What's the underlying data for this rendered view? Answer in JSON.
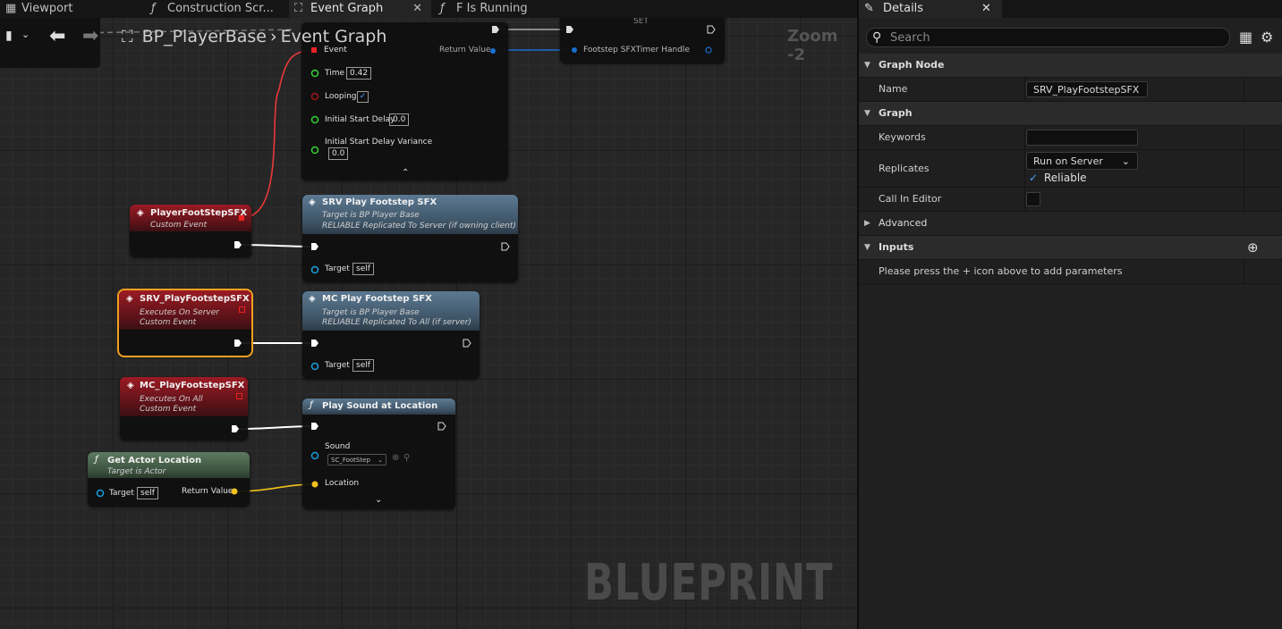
{
  "tabs": [
    {
      "label": "Viewport",
      "icon": "viewport-icon"
    },
    {
      "label": "Construction Scr...",
      "icon": "function-icon"
    },
    {
      "label": "Event Graph",
      "icon": "event-graph-icon",
      "active": true
    },
    {
      "label": "F Is Running",
      "icon": "function-icon"
    }
  ],
  "breadcrumb": {
    "blueprint": "BP_PlayerBase",
    "graph": "Event Graph"
  },
  "zoom": "Zoom -2",
  "watermark": "BLUEPRINT",
  "timer_node": {
    "set_label": "SET",
    "event": "Event",
    "return_value": "Return Value",
    "time_label": "Time",
    "time_value": "0.42",
    "looping_label": "Looping",
    "initial_start_delay_label": "Initial Start Delay",
    "initial_start_delay_value": "0.0",
    "variance_label": "Initial Start Delay Variance",
    "variance_value": "0.0",
    "handle_label": "Footstep SFXTimer Handle"
  },
  "nodes": {
    "player_footstep": {
      "title": "PlayerFootStepSFX",
      "subtitle": "Custom Event"
    },
    "srv_call": {
      "title": "SRV Play Footstep SFX",
      "line1": "Target is BP Player Base",
      "line2": "RELIABLE Replicated To Server (if owning client)",
      "target_label": "Target",
      "target_value": "self"
    },
    "srv_event": {
      "title": "SRV_PlayFootstepSFX",
      "line1": "Executes On Server",
      "line2": "Custom Event"
    },
    "mc_call": {
      "title": "MC Play Footstep SFX",
      "line1": "Target is BP Player Base",
      "line2": "RELIABLE Replicated To All (if server)",
      "target_label": "Target",
      "target_value": "self"
    },
    "mc_event": {
      "title": "MC_PlayFootstepSFX",
      "line1": "Executes On All",
      "line2": "Custom Event"
    },
    "play_sound": {
      "title": "Play Sound at Location",
      "sound_label": "Sound",
      "sound_value": "SC_FootStep",
      "location_label": "Location"
    },
    "get_actor_location": {
      "title": "Get Actor Location",
      "subtitle": "Target is Actor",
      "target_label": "Target",
      "target_value": "self",
      "return_label": "Return Value"
    }
  },
  "details": {
    "tab_label": "Details",
    "search_placeholder": "Search",
    "sections": {
      "graph_node": "Graph Node",
      "graph": "Graph",
      "advanced": "Advanced",
      "inputs": "Inputs"
    },
    "name_label": "Name",
    "name_value": "SRV_PlayFootstepSFX",
    "keywords_label": "Keywords",
    "keywords_value": "",
    "replicates_label": "Replicates",
    "replicates_value": "Run on Server",
    "reliable_label": "Reliable",
    "call_in_editor_label": "Call In Editor",
    "inputs_hint": "Please press the + icon above to add parameters"
  },
  "colors": {
    "exec_wire": "#ffffff",
    "event_wire": "#e8393a",
    "vector_wire": "#f2c21c",
    "object_pin": "#18a0e0",
    "bool_pin": "#a01818",
    "float_pin": "#34d434",
    "selection": "#f0a020"
  }
}
